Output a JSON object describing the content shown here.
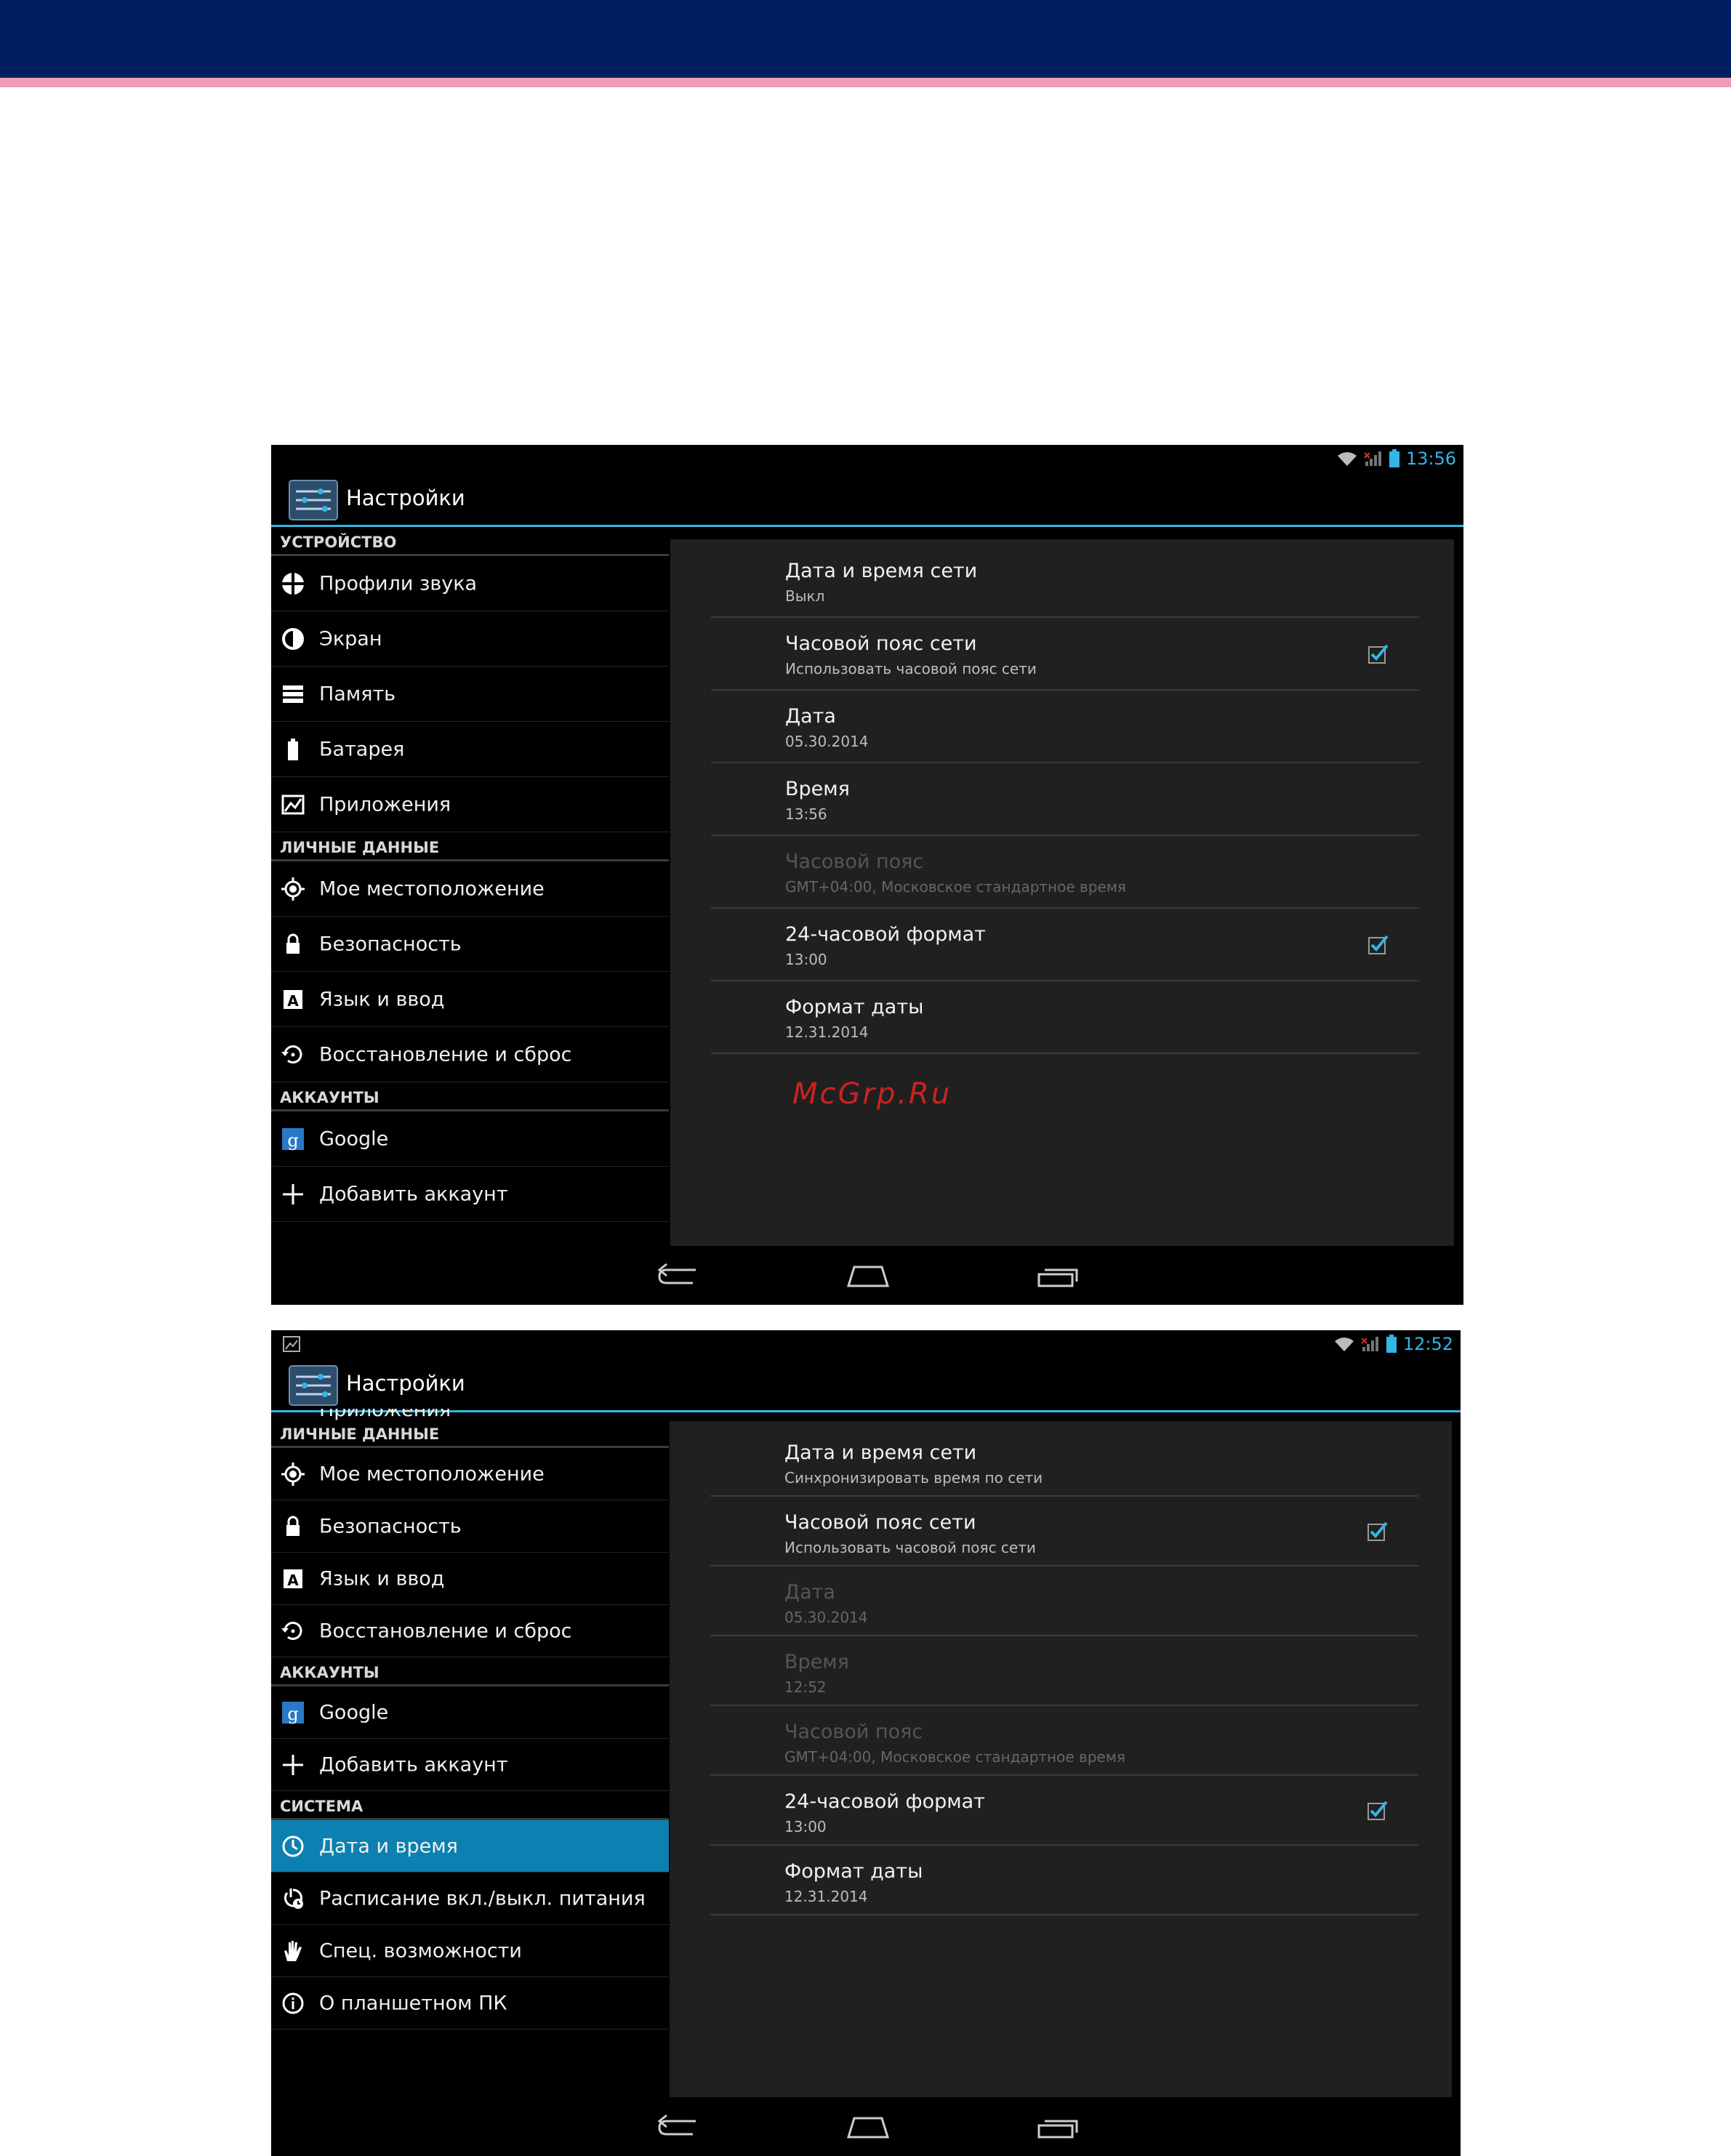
{
  "colors": {
    "banner": "#001f61",
    "stripe": "#f29bb7",
    "accent": "#33b5e5",
    "selected": "#0c80b0"
  },
  "screen1": {
    "status_time": "13:56",
    "title": "Настройки",
    "sections": [
      {
        "header": "УСТРОЙСТВО",
        "items": [
          {
            "label": "Профили звука",
            "icon": "sound-profile-icon"
          },
          {
            "label": "Экран",
            "icon": "display-icon"
          },
          {
            "label": "Память",
            "icon": "storage-icon"
          },
          {
            "label": "Батарея",
            "icon": "battery-icon"
          },
          {
            "label": "Приложения",
            "icon": "apps-icon"
          }
        ]
      },
      {
        "header": "ЛИЧНЫЕ ДАННЫЕ",
        "items": [
          {
            "label": "Мое местоположение",
            "icon": "location-icon"
          },
          {
            "label": "Безопасность",
            "icon": "lock-icon"
          },
          {
            "label": "Язык и ввод",
            "icon": "language-icon"
          },
          {
            "label": "Восстановление и сброс",
            "icon": "restore-icon"
          }
        ]
      },
      {
        "header": "АККАУНТЫ",
        "items": [
          {
            "label": "Google",
            "icon": "google-icon"
          },
          {
            "label": "Добавить аккаунт",
            "icon": "plus-icon"
          }
        ]
      }
    ],
    "prefs": [
      {
        "title": "Дата и время сети",
        "summary": "Выкл",
        "checked": false,
        "disabled": false
      },
      {
        "title": "Часовой пояс сети",
        "summary": "Использовать часовой пояс сети",
        "checked": true,
        "disabled": false
      },
      {
        "title": "Дата",
        "summary": "05.30.2014",
        "checked": false,
        "disabled": false
      },
      {
        "title": "Время",
        "summary": "13:56",
        "checked": false,
        "disabled": false
      },
      {
        "title": "Часовой пояс",
        "summary": "GMT+04:00, Московское стандартное время",
        "checked": false,
        "disabled": true
      },
      {
        "title": "24-часовой формат",
        "summary": "13:00",
        "checked": true,
        "disabled": false
      },
      {
        "title": "Формат даты",
        "summary": "12.31.2014",
        "checked": false,
        "disabled": false
      }
    ],
    "watermark": "McGrp.Ru"
  },
  "screen2": {
    "status_time": "12:52",
    "title": "Настройки",
    "partial_item": "Приложения",
    "sections": [
      {
        "header": "ЛИЧНЫЕ ДАННЫЕ",
        "items": [
          {
            "label": "Мое местоположение",
            "icon": "location-icon"
          },
          {
            "label": "Безопасность",
            "icon": "lock-icon"
          },
          {
            "label": "Язык и ввод",
            "icon": "language-icon"
          },
          {
            "label": "Восстановление и сброс",
            "icon": "restore-icon"
          }
        ]
      },
      {
        "header": "АККАУНТЫ",
        "items": [
          {
            "label": "Google",
            "icon": "google-icon"
          },
          {
            "label": "Добавить аккаунт",
            "icon": "plus-icon"
          }
        ]
      },
      {
        "header": "СИСТЕМА",
        "items": [
          {
            "label": "Дата и время",
            "icon": "clock-icon",
            "selected": true
          },
          {
            "label": "Расписание вкл./выкл. питания",
            "icon": "power-schedule-icon"
          },
          {
            "label": "Спец. возможности",
            "icon": "accessibility-icon"
          },
          {
            "label": "О планшетном ПК",
            "icon": "info-icon"
          }
        ]
      }
    ],
    "prefs": [
      {
        "title": "Дата и время сети",
        "summary": "Синхронизировать время по сети",
        "checked": false,
        "disabled": false
      },
      {
        "title": "Часовой пояс сети",
        "summary": "Использовать часовой пояс сети",
        "checked": true,
        "disabled": false
      },
      {
        "title": "Дата",
        "summary": "05.30.2014",
        "checked": false,
        "disabled": true
      },
      {
        "title": "Время",
        "summary": "12:52",
        "checked": false,
        "disabled": true
      },
      {
        "title": "Часовой пояс",
        "summary": "GMT+04:00, Московское стандартное время",
        "checked": false,
        "disabled": true
      },
      {
        "title": "24-часовой формат",
        "summary": "13:00",
        "checked": true,
        "disabled": false
      },
      {
        "title": "Формат даты",
        "summary": "12.31.2014",
        "checked": false,
        "disabled": false
      }
    ]
  }
}
